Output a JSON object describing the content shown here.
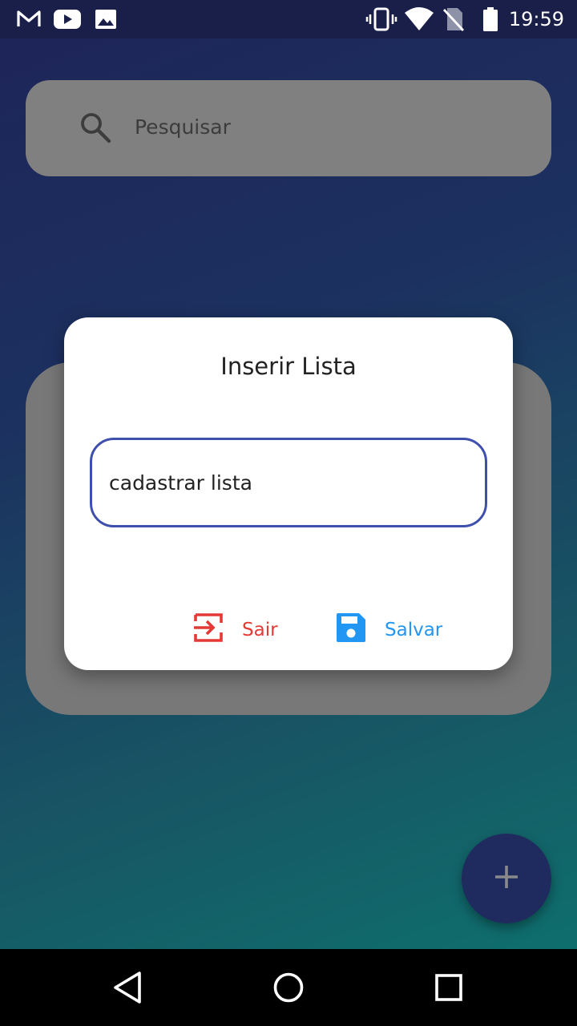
{
  "status_bar": {
    "time": "19:59",
    "left_icons": [
      "gmail-icon",
      "youtube-icon",
      "gallery-icon"
    ],
    "right_icons": [
      "vibrate-icon",
      "wifi-icon",
      "no-sim-icon",
      "battery-icon"
    ]
  },
  "search": {
    "placeholder": "Pesquisar",
    "icon": "search-icon"
  },
  "dialog": {
    "title": "Inserir Lista",
    "input_value": "cadastrar lista",
    "exit_label": "Sair",
    "save_label": "Salvar",
    "exit_color": "#e53935",
    "save_color": "#2196f3",
    "input_border_color": "#3f4fae"
  },
  "fab": {
    "icon": "plus-icon"
  },
  "nav_bar": {
    "icons": [
      "back-icon",
      "home-icon",
      "recents-icon"
    ]
  }
}
